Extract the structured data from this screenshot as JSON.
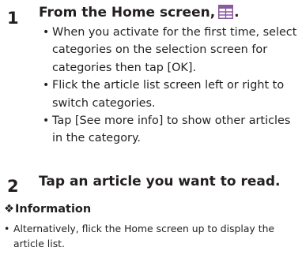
{
  "steps": [
    {
      "number": "1",
      "title_before_icon": "From the Home screen,",
      "icon": "article-list-icon",
      "title_after_icon": ".",
      "bullets": [
        "When you activate for the first time, select categories on the selection screen for categories then tap [OK].",
        "Flick the article list screen left or right to switch categories.",
        "Tap [See more info] to show other articles in the category."
      ]
    },
    {
      "number": "2",
      "title": "Tap an article you want to read."
    }
  ],
  "information": {
    "mark": "❖",
    "heading": "Information",
    "items": [
      "Alternatively, flick the Home screen up to display the article list."
    ]
  },
  "colors": {
    "text": "#231f20",
    "icon_purple": "#8a5a9e"
  }
}
